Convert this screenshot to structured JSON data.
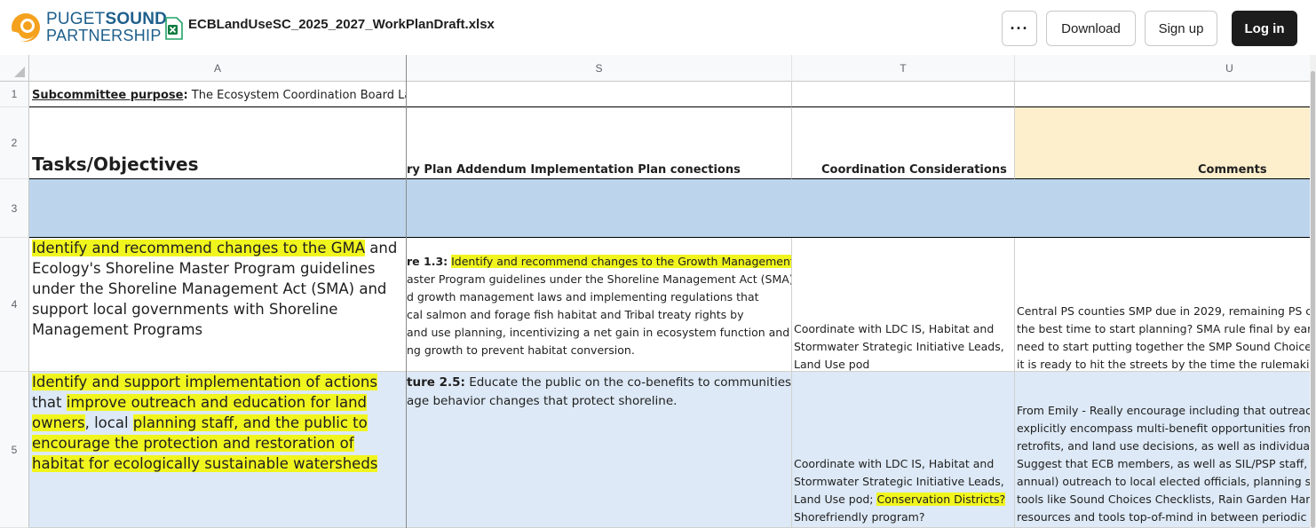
{
  "app": {
    "logo_line1_regular": "PUGET",
    "logo_line1_bold": "SOUND",
    "logo_line2": "PARTNERSHIP",
    "file_icon": "excel-file-icon",
    "filename": "ECBLandUseSC_2025_2027_WorkPlanDraft.xlsx"
  },
  "toolbar": {
    "more_label": "···",
    "download_label": "Download",
    "signup_label": "Sign up",
    "login_label": "Log in"
  },
  "columns": [
    "A",
    "S",
    "T",
    "U"
  ],
  "rows": [
    "1",
    "2",
    "3",
    "4",
    "5"
  ],
  "cells": {
    "A1_bold": "Subcommittee purpose",
    "A1_colon": ":",
    "A1_text": " The Ecosystem Coordination Board Land",
    "A2": "Tasks/Objectives",
    "S2": "ry Plan Addendum Implementation Plan conections",
    "T2": "Coordination Considerations",
    "U2": "Comments",
    "A4": {
      "hl": "Identify and recommend changes to the GMA",
      "rest": " and Ecology's Shoreline Master Program guidelines under the Shoreline Management Act (SMA) and support local governments with Shoreline Management Programs"
    },
    "S4": {
      "lead_bold": "re 1.3:",
      "lead_hl": "Identify and recommend changes to the Growth Management",
      "lines": [
        "aster Program guidelines under the Shoreline Management Act (SMA),",
        "d growth management laws and implementing regulations that",
        "cal salmon and forage fish habitat and Tribal treaty rights by",
        "and use planning, incentivizing a net gain in ecosystem function and",
        "ng growth to prevent habitat conversion."
      ]
    },
    "T4": [
      "Coordinate with LDC IS, Habitat and",
      "Stormwater Strategic Initiative Leads,",
      "Land Use pod"
    ],
    "U4": [
      "Central PS counties SMP due in 2029, remaining PS cou",
      "the best time to start planning? SMA rule final by early",
      "need to start putting together the SMP Sound Choices C",
      "it is ready to hit the streets by the time the rulemaking"
    ],
    "A5": {
      "hl1": "Identify and support implementation of actions",
      "t1": " that ",
      "hl2": "improve outreach and education for land owners",
      "t2": ", local ",
      "hl3": "planning staff, and the public to encourage the protection and restoration of habitat for ecologically sustainable watersheds"
    },
    "S5": {
      "lead_bold": "ture 2.5:",
      "line1": " Educate the public on the co-benefits to communities",
      "line2": "age behavior changes that protect shoreline."
    },
    "T5": {
      "l1": "Coordinate with LDC IS, Habitat and",
      "l2": "Stormwater Strategic Initiative Leads,",
      "l3a": "Land Use pod; ",
      "l3hl": "Conservation Districts?",
      "l4": "Shorefriendly program?"
    },
    "U5": [
      "From Emily - Really encourage including that outreach a",
      "explicitly encompass multi-benefit opportunities from u",
      "retrofits, and land use decisions, as well as individual pr",
      "Suggest that ECB members, as well as SIL/PSP staff, thin",
      "annual) outreach to local elected officials, planning staf",
      "tools like Sound Choices Checklists, Rain Garden Handb",
      "resources and tools top-of-mind in between periodic co"
    ]
  },
  "colors": {
    "header_blue": "#bcd5ed",
    "row_light_blue": "#dde9f6",
    "comments_peach": "#fdefcc",
    "highlight_yellow": "#f1f51e",
    "brand_blue": "#1e5f8c",
    "brand_orange": "#f4a11d"
  }
}
